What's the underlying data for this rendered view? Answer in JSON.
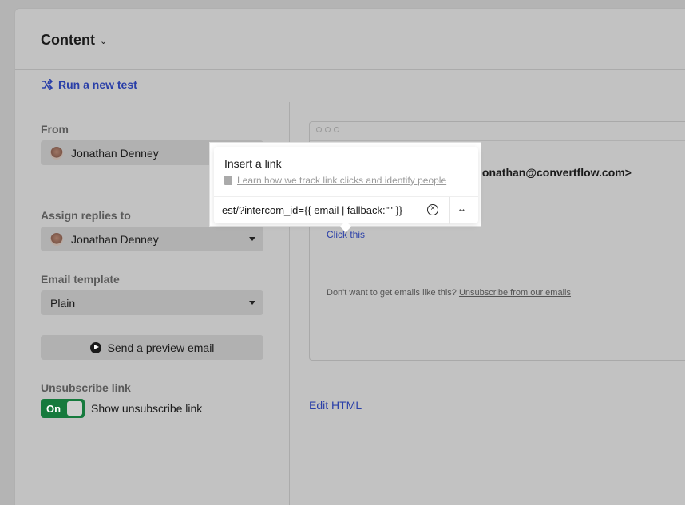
{
  "header": {
    "title": "Content"
  },
  "run_test": {
    "label": "Run a new test"
  },
  "from": {
    "label": "From",
    "value": "Jonathan Denney"
  },
  "assign": {
    "label": "Assign replies to",
    "value": "Jonathan Denney"
  },
  "template": {
    "label": "Email template",
    "value": "Plain"
  },
  "preview_button": {
    "label": "Send a preview email"
  },
  "unsubscribe": {
    "label": "Unsubscribe link",
    "toggle_state": "On",
    "toggle_label": "Show unsubscribe link"
  },
  "email_preview": {
    "from_text": "jonathan@convertflow.com>",
    "link_text": "Click this",
    "footer_text": "Don't want to get emails like this?",
    "footer_link": "Unsubscribe from our emails"
  },
  "edit_html": {
    "label": "Edit HTML"
  },
  "link_popup": {
    "title": "Insert a link",
    "learn_link": "Learn how we track link clicks and identify people",
    "url_value": "est/?intercom_id={{ email | fallback:\"\" }}",
    "clear_icon": "circle-x-icon",
    "unlink_icon": "unlink-icon"
  }
}
